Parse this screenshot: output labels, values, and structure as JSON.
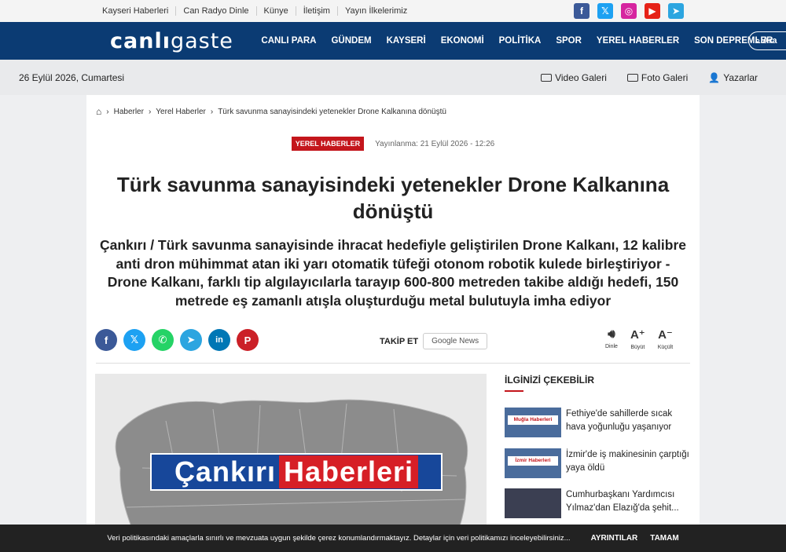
{
  "topbar": {
    "links": [
      "Kayseri Haberleri",
      "Can Radyo Dinle",
      "Künye",
      "İletişim",
      "Yayın İlkelerimiz"
    ],
    "social": [
      {
        "icon": "facebook-icon",
        "glyph": "f",
        "color": "#3b5998"
      },
      {
        "icon": "x-icon",
        "glyph": "𝕏",
        "color": "#1da1f2"
      },
      {
        "icon": "instagram-icon",
        "glyph": "◎",
        "color": "#d6249f"
      },
      {
        "icon": "youtube-icon",
        "glyph": "▶",
        "color": "#e62117"
      },
      {
        "icon": "telegram-icon",
        "glyph": "➤",
        "color": "#2ca5e0"
      }
    ]
  },
  "nav": {
    "logo_a": "canlı",
    "logo_b": "gaste",
    "items": [
      "CANLI PARA",
      "GÜNDEM",
      "KAYSERİ",
      "EKONOMİ",
      "POLİTİKA",
      "SPOR",
      "YEREL HABERLER",
      "SON DEPREMLER"
    ],
    "search_label": "Ara"
  },
  "datebar": {
    "date": "26 Eylül 2026, Cumartesi",
    "video": "Video Galeri",
    "photo": "Foto Galeri",
    "authors": "Yazarlar"
  },
  "article": {
    "breadcrumb": [
      "Haberler",
      "Yerel Haberler",
      "Türk savunma sanayisindeki yetenekler Drone Kalkanına dönüştü"
    ],
    "category": "YEREL HABERLER",
    "published": "Yayınlanma: 21 Eylül 2026 - 12:26",
    "title": "Türk savunma sanayisindeki yetenekler Drone Kalkanına dönüştü",
    "summary": "Çankırı / Türk savunma sanayisinde ihracat hedefiyle geliştirilen Drone Kalkanı, 12 kalibre anti dron mühimmat atan iki yarı otomatik tüfeği otonom robotik kulede birleştiriyor - Drone Kalkanı, farklı tip algılayıcılarla tarayıp 600-800 metreden takibe aldığı hedefi, 150 metrede eş zamanlı atışla oluşturduğu metal bulutuyla imha ediyor",
    "follow_label": "TAKİP ET",
    "google_news": "Google News",
    "tools": {
      "listen": "Dinle",
      "bigger": "Büyüt",
      "smaller": "Küçült"
    },
    "image_text_a": "Çankırı",
    "image_text_b": "Haberleri"
  },
  "share": [
    {
      "icon": "facebook-icon",
      "glyph": "f",
      "color": "#3b5998"
    },
    {
      "icon": "x-icon",
      "glyph": "𝕏",
      "color": "#1da1f2"
    },
    {
      "icon": "whatsapp-icon",
      "glyph": "✆",
      "color": "#25d366"
    },
    {
      "icon": "telegram-icon",
      "glyph": "➤",
      "color": "#2ca5e0"
    },
    {
      "icon": "linkedin-icon",
      "glyph": "in",
      "color": "#0077b5"
    },
    {
      "icon": "pinterest-icon",
      "glyph": "P",
      "color": "#cb2027"
    }
  ],
  "sidebar": {
    "title": "İLGİNİZİ ÇEKEBİLİR",
    "items": [
      {
        "text": "Fethiye'de sahillerde sıcak hava yoğunluğu yaşanıyor",
        "thumb": "Muğla Haberleri"
      },
      {
        "text": "İzmir'de iş makinesinin çarptığı yaya öldü",
        "thumb": "İzmir Haberleri"
      },
      {
        "text": "Cumhurbaşkanı Yardımcısı Yılmaz'dan Elazığ'da şehit...",
        "thumb": ""
      }
    ]
  },
  "cookie": {
    "text": "Veri politikasındaki amaçlarla sınırlı ve mevzuata uygun şekilde çerez konumlandırmaktayız. Detaylar için veri politikamızı inceleyebilirsiniz...",
    "settings": "AYRINTILAR",
    "ok": "TAMAM"
  },
  "colors": {
    "nav": "#0b3b73",
    "accent": "#c4161c"
  }
}
